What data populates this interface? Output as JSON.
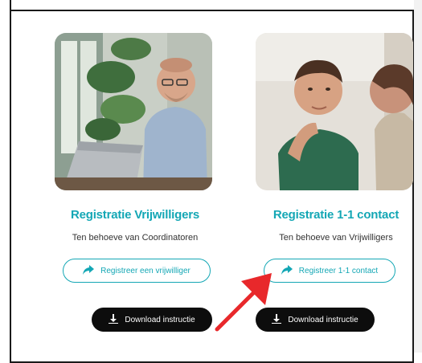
{
  "cards": [
    {
      "title": "Registratie Vrijwilligers",
      "subtitle": "Ten behoeve van Coordinatoren",
      "register_label": "Registreer een vrijwilliger",
      "download_label": "Download instructie"
    },
    {
      "title": "Registratie 1-1 contact",
      "subtitle": "Ten behoeve van Vrijwilligers",
      "register_label": "Registreer 1-1 contact",
      "download_label": "Download instructie"
    }
  ],
  "colors": {
    "accent": "#14a7b5",
    "dark_button": "#0d0d0d",
    "annotation_arrow": "#e8282b"
  }
}
